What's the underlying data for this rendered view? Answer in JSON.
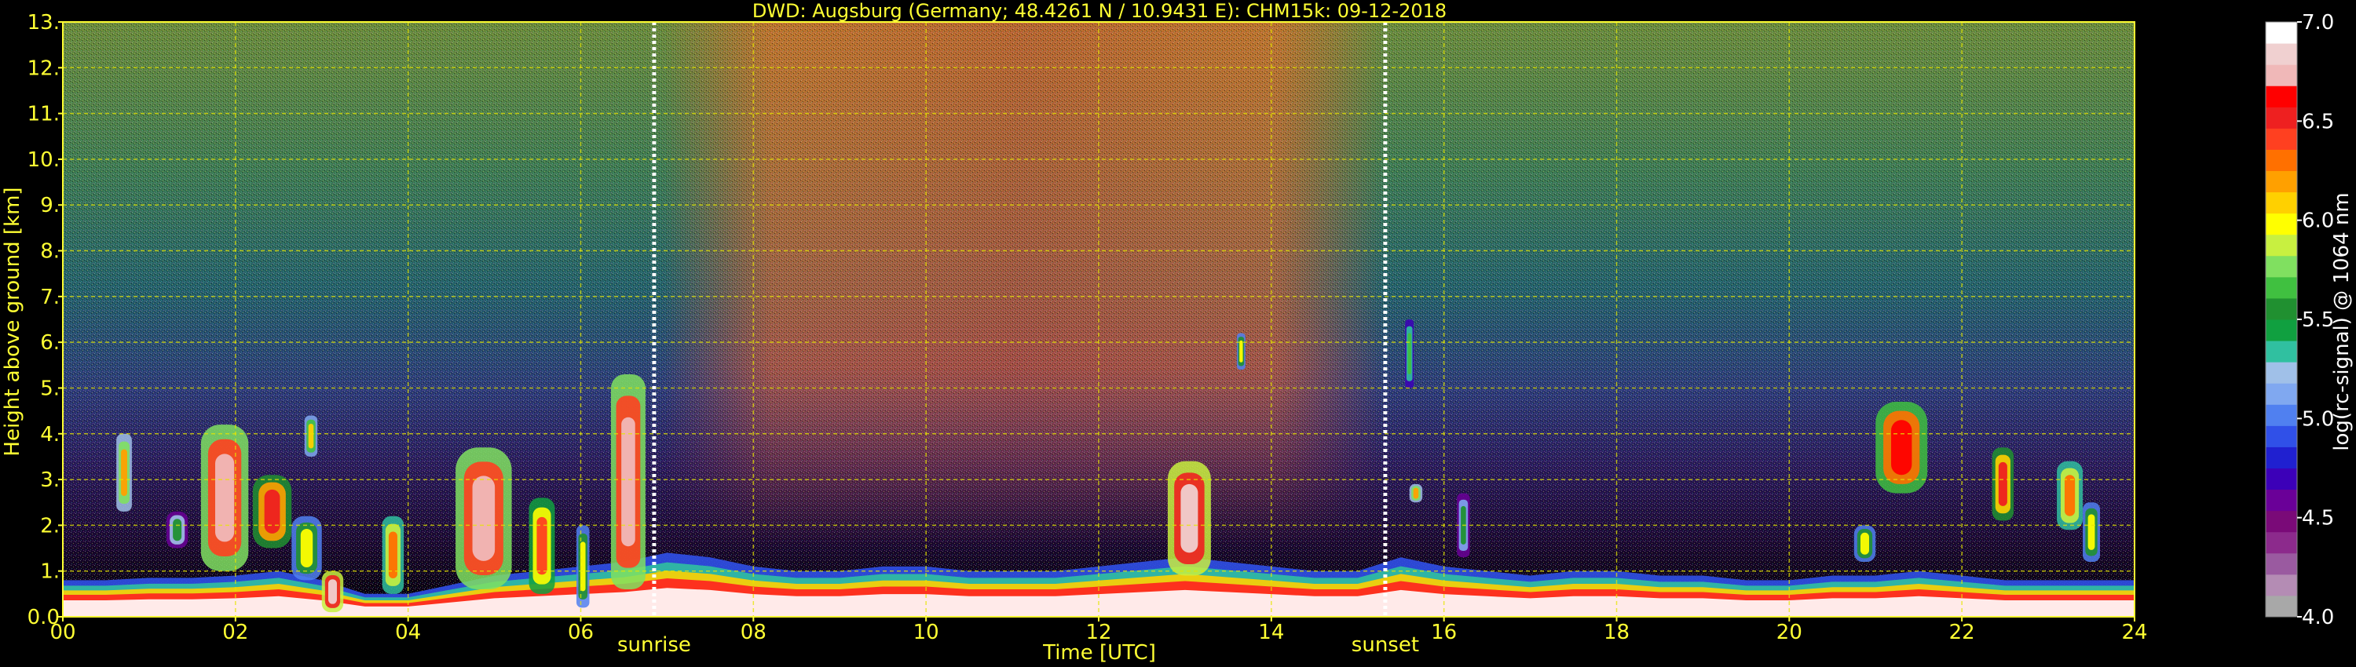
{
  "chart_data": {
    "type": "heatmap",
    "title": "DWD: Augsburg (Germany; 48.4261 N / 10.9431 E):    CHM15k: 09-12-2018",
    "xlabel": "Time [UTC]",
    "ylabel": "Height above ground [km]",
    "xlim": [
      0,
      24
    ],
    "ylim": [
      0,
      13
    ],
    "x_ticks": [
      0,
      2,
      4,
      6,
      8,
      10,
      12,
      14,
      16,
      18,
      20,
      22,
      24
    ],
    "x_tick_labels": [
      "00",
      "02",
      "04",
      "06",
      "08",
      "10",
      "12",
      "14",
      "16",
      "18",
      "20",
      "22",
      "24"
    ],
    "y_ticks": [
      0,
      1,
      2,
      3,
      4,
      5,
      6,
      7,
      8,
      9,
      10,
      11,
      12,
      13
    ],
    "y_tick_labels": [
      "0.0",
      "1.",
      "2.",
      "3.",
      "4.",
      "5.",
      "6.",
      "7.",
      "8.",
      "9.",
      "10.",
      "11.",
      "12.",
      "13."
    ],
    "grid": true,
    "colorbar": {
      "label": "log(rc-signal) @ 1064 nm",
      "range": [
        4.0,
        7.0
      ],
      "ticks": [
        4.0,
        4.5,
        5.0,
        5.5,
        6.0,
        6.5,
        7.0
      ],
      "tick_labels": [
        "4.0",
        "4.5",
        "5.0",
        "5.5",
        "6.0",
        "6.5",
        "7.0"
      ],
      "colors": [
        "#a8a8a8",
        "#b48cb4",
        "#9a5aa0",
        "#8c2a8c",
        "#7a0a78",
        "#6a0098",
        "#3c00b8",
        "#2020d0",
        "#3050e8",
        "#5080f0",
        "#80a8f0",
        "#a0c0e8",
        "#30c0a0",
        "#10a040",
        "#209030",
        "#40c040",
        "#80e060",
        "#c8f040",
        "#ffff00",
        "#ffd000",
        "#ffa000",
        "#ff7000",
        "#ff4020",
        "#ee2020",
        "#ff0000",
        "#f0b8b8",
        "#f0d0d0",
        "#ffffff"
      ]
    },
    "annotations": [
      {
        "label": "sunrise",
        "x": 6.85
      },
      {
        "label": "sunset",
        "x": 15.32
      }
    ],
    "boundary_layer": {
      "time": [
        0,
        0.5,
        1,
        1.5,
        2,
        2.5,
        3,
        3.5,
        4,
        4.5,
        5,
        5.5,
        6,
        6.5,
        7,
        7.5,
        8,
        8.5,
        9,
        9.5,
        10,
        10.5,
        11,
        11.5,
        12,
        12.5,
        13,
        13.5,
        14,
        14.5,
        15,
        15.5,
        16,
        16.5,
        17,
        17.5,
        18,
        18.5,
        19,
        19.5,
        20,
        20.5,
        21,
        21.5,
        22,
        22.5,
        23,
        23.5,
        24
      ],
      "top_km": [
        0.8,
        0.8,
        0.85,
        0.85,
        0.9,
        1.0,
        0.8,
        0.5,
        0.5,
        0.7,
        0.9,
        1.0,
        1.1,
        1.2,
        1.4,
        1.3,
        1.1,
        1.0,
        1.0,
        1.1,
        1.1,
        1.0,
        1.0,
        1.0,
        1.1,
        1.2,
        1.3,
        1.2,
        1.1,
        1.0,
        1.0,
        1.3,
        1.1,
        1.0,
        0.9,
        1.0,
        1.0,
        0.9,
        0.9,
        0.8,
        0.8,
        0.9,
        0.9,
        1.0,
        0.9,
        0.8,
        0.8,
        0.8,
        0.8
      ]
    },
    "cloud_features": [
      {
        "x0": 0.62,
        "x1": 0.8,
        "y0": 2.3,
        "y1": 4.0,
        "level": 6.2
      },
      {
        "x0": 1.2,
        "x1": 1.45,
        "y0": 1.5,
        "y1": 2.3,
        "level": 5.6
      },
      {
        "x0": 1.6,
        "x1": 2.15,
        "y0": 1.0,
        "y1": 4.2,
        "level": 6.8
      },
      {
        "x0": 2.2,
        "x1": 2.65,
        "y0": 1.5,
        "y1": 3.1,
        "level": 6.6
      },
      {
        "x0": 2.65,
        "x1": 3.0,
        "y0": 0.8,
        "y1": 2.2,
        "level": 6.0
      },
      {
        "x0": 2.8,
        "x1": 2.95,
        "y0": 3.5,
        "y1": 4.4,
        "level": 6.1
      },
      {
        "x0": 3.0,
        "x1": 3.25,
        "y0": 0.1,
        "y1": 1.0,
        "level": 6.9
      },
      {
        "x0": 3.7,
        "x1": 3.95,
        "y0": 0.5,
        "y1": 2.2,
        "level": 6.3
      },
      {
        "x0": 4.55,
        "x1": 5.2,
        "y0": 0.6,
        "y1": 3.7,
        "level": 6.8
      },
      {
        "x0": 5.4,
        "x1": 5.7,
        "y0": 0.5,
        "y1": 2.6,
        "level": 6.4
      },
      {
        "x0": 5.95,
        "x1": 6.1,
        "y0": 0.2,
        "y1": 2.0,
        "level": 6.0
      },
      {
        "x0": 6.35,
        "x1": 6.75,
        "y0": 0.6,
        "y1": 5.3,
        "level": 6.8
      },
      {
        "x0": 12.8,
        "x1": 13.3,
        "y0": 0.9,
        "y1": 3.4,
        "level": 6.9
      },
      {
        "x0": 13.6,
        "x1": 13.7,
        "y0": 5.4,
        "y1": 6.2,
        "level": 6.0
      },
      {
        "x0": 15.55,
        "x1": 15.65,
        "y0": 5.0,
        "y1": 6.5,
        "level": 5.7
      },
      {
        "x0": 15.6,
        "x1": 15.75,
        "y0": 2.5,
        "y1": 2.9,
        "level": 6.2
      },
      {
        "x0": 16.15,
        "x1": 16.3,
        "y0": 1.3,
        "y1": 2.7,
        "level": 5.5
      },
      {
        "x0": 20.75,
        "x1": 21.0,
        "y0": 1.2,
        "y1": 2.0,
        "level": 6.0
      },
      {
        "x0": 21.0,
        "x1": 21.6,
        "y0": 2.7,
        "y1": 4.7,
        "level": 6.7
      },
      {
        "x0": 22.35,
        "x1": 22.6,
        "y0": 2.1,
        "y1": 3.7,
        "level": 6.5
      },
      {
        "x0": 23.1,
        "x1": 23.4,
        "y0": 1.9,
        "y1": 3.4,
        "level": 6.3
      },
      {
        "x0": 23.4,
        "x1": 23.6,
        "y0": 1.2,
        "y1": 2.5,
        "level": 6.0
      }
    ]
  }
}
